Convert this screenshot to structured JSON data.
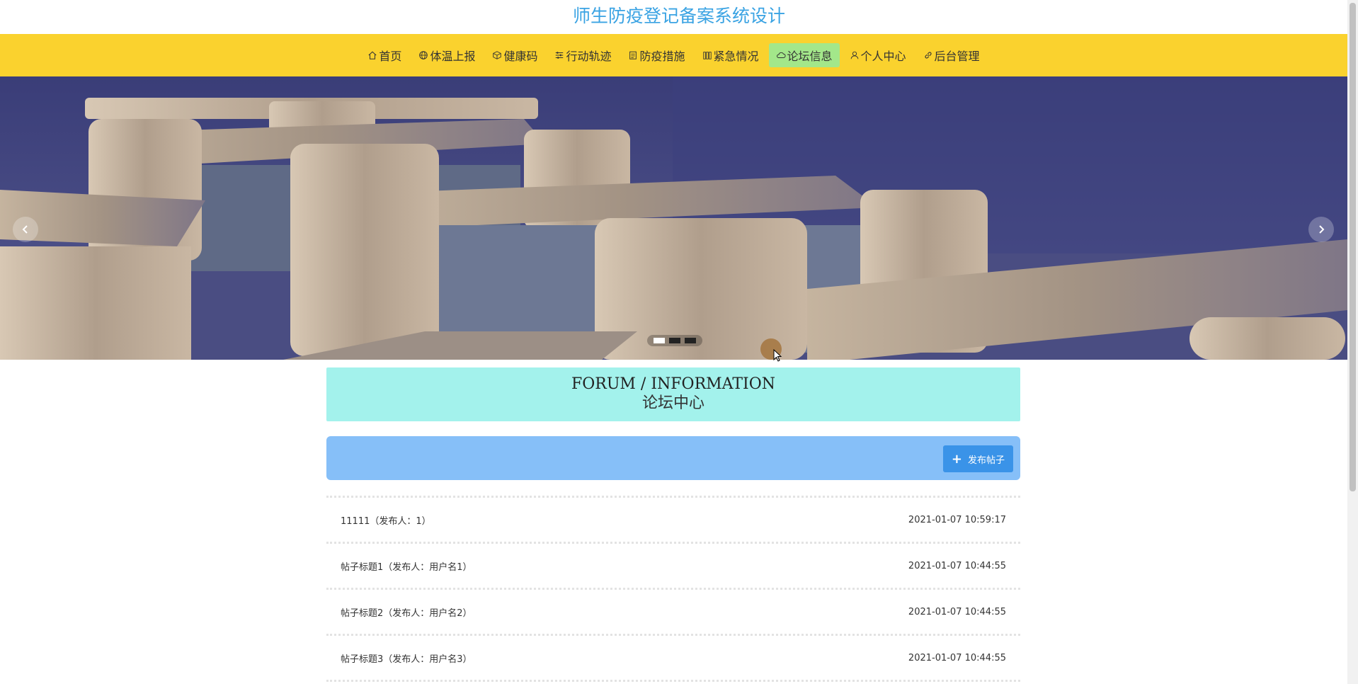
{
  "site": {
    "title": "师生防疫登记备案系统设计"
  },
  "nav": {
    "items": [
      {
        "label": "首页",
        "icon": "home-icon"
      },
      {
        "label": "体温上报",
        "icon": "globe-icon"
      },
      {
        "label": "健康码",
        "icon": "box-icon"
      },
      {
        "label": "行动轨迹",
        "icon": "sliders-icon"
      },
      {
        "label": "防疫措施",
        "icon": "calendar-icon"
      },
      {
        "label": "紧急情况",
        "icon": "grid-icon"
      },
      {
        "label": "论坛信息",
        "icon": "cloud-icon",
        "active": true
      },
      {
        "label": "个人中心",
        "icon": "user-icon"
      },
      {
        "label": "后台管理",
        "icon": "link-icon"
      }
    ]
  },
  "carousel": {
    "slides": 3,
    "active_index": 0
  },
  "forum": {
    "heading_en": "FORUM / INFORMATION",
    "heading_cn": "论坛中心",
    "publish_label": "发布帖子",
    "posts": [
      {
        "title": "11111（发布人：1）",
        "date": "2021-01-07 10:59:17"
      },
      {
        "title": "帖子标题1（发布人：用户名1）",
        "date": "2021-01-07 10:44:55"
      },
      {
        "title": "帖子标题2（发布人：用户名2）",
        "date": "2021-01-07 10:44:55"
      },
      {
        "title": "帖子标题3（发布人：用户名3）",
        "date": "2021-01-07 10:44:55"
      }
    ]
  },
  "colors": {
    "nav_bg": "#fad22e",
    "active_nav": "#a3e78a",
    "title": "#3aa3e3",
    "forum_header_bg": "#a3f2ec",
    "toolbar_bg": "#86bff8",
    "button_bg": "#3a93e8"
  }
}
